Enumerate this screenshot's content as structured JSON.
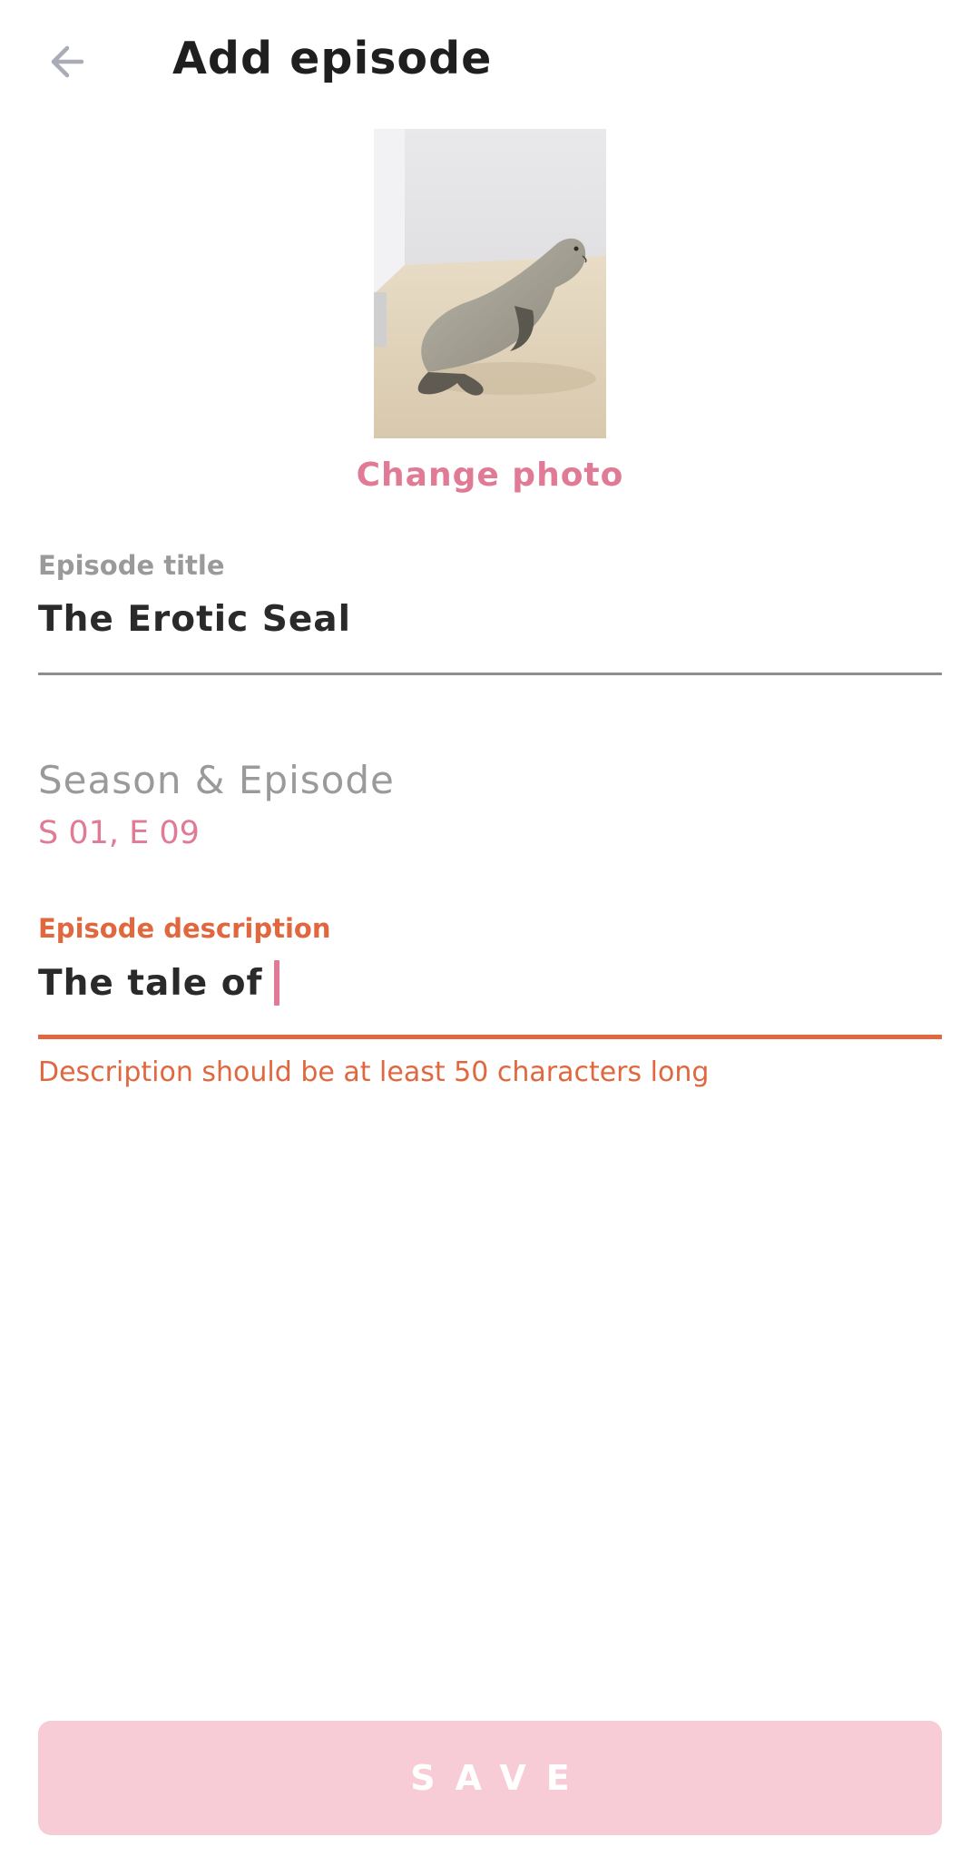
{
  "header": {
    "title": "Add episode",
    "back_icon": "arrow-left-icon"
  },
  "photo": {
    "subject": "seal",
    "change_label": "Change photo"
  },
  "form": {
    "title_field": {
      "label": "Episode title",
      "value": "The Erotic Seal"
    },
    "season_field": {
      "label": "Season & Episode",
      "value": "S 01, E 09"
    },
    "description_field": {
      "label": "Episode description",
      "value": "The tale of",
      "error": "Description should be at least 50 characters long"
    }
  },
  "save_button": {
    "label": "SAVE"
  },
  "colors": {
    "accent_pink": "#e07a95",
    "error_orange": "#e0673e",
    "save_disabled_bg": "#f7ccd6",
    "label_gray": "#9a9a9a",
    "underline_gray": "#8e8e8e",
    "icon_gray": "#a9acb6"
  }
}
